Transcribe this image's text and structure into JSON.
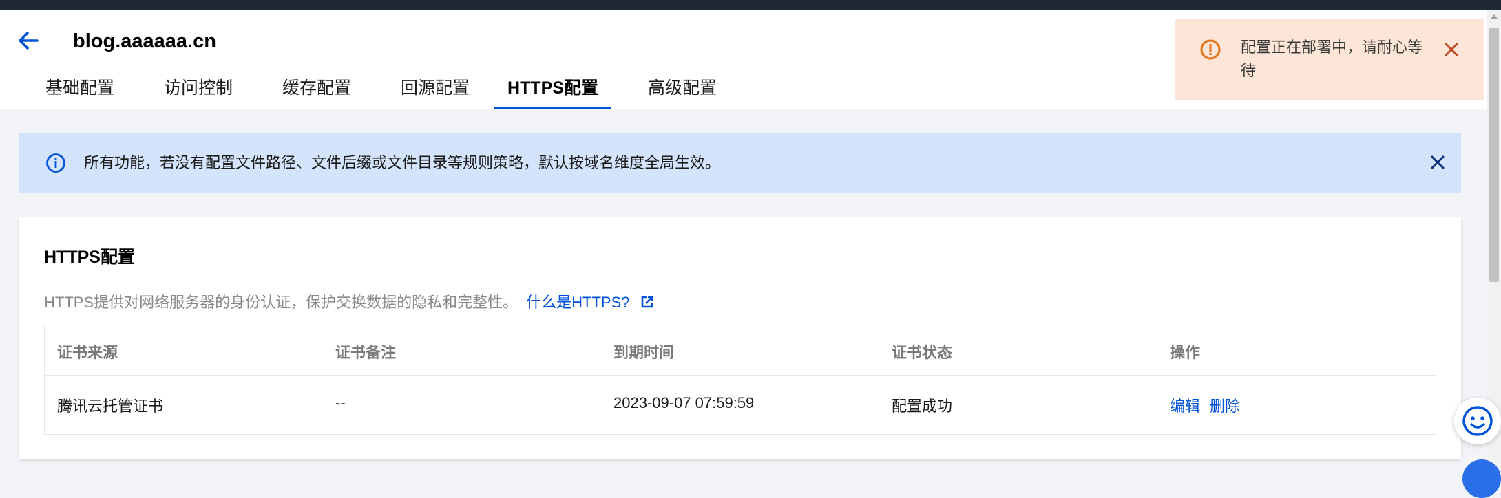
{
  "header": {
    "domain": "blog.aaaaaa.cn",
    "tabs": [
      {
        "label": "基础配置"
      },
      {
        "label": "访问控制"
      },
      {
        "label": "缓存配置"
      },
      {
        "label": "回源配置"
      },
      {
        "label": "HTTPS配置"
      },
      {
        "label": "高级配置"
      }
    ],
    "active_tab": "HTTPS配置"
  },
  "toast": {
    "message": "配置正在部署中，请耐心等待"
  },
  "info_bar": {
    "text": "所有功能，若没有配置文件路径、文件后缀或文件目录等规则策略，默认按域名维度全局生效。"
  },
  "card": {
    "title": "HTTPS配置",
    "description": "HTTPS提供对网络服务器的身份认证，保护交换数据的隐私和完整性。",
    "link": "什么是HTTPS?",
    "table": {
      "columns": [
        "证书来源",
        "证书备注",
        "到期时间",
        "证书状态",
        "操作"
      ],
      "rows": [
        {
          "source": "腾讯云托管证书",
          "note": "--",
          "expiry": "2023-09-07 07:59:59",
          "status": "配置成功",
          "actions": [
            "编辑",
            "删除"
          ]
        }
      ]
    }
  },
  "colors": {
    "accent": "#0052d9",
    "warning": "#e37318",
    "info_bg": "#d4e4fc",
    "toast_bg": "#fde6d7"
  },
  "icons": {
    "back": "arrow-left-icon",
    "warning": "exclamation-circle-icon",
    "info": "info-circle-icon",
    "close": "close-icon",
    "external": "external-link-icon",
    "help": "smiley-face-icon"
  }
}
